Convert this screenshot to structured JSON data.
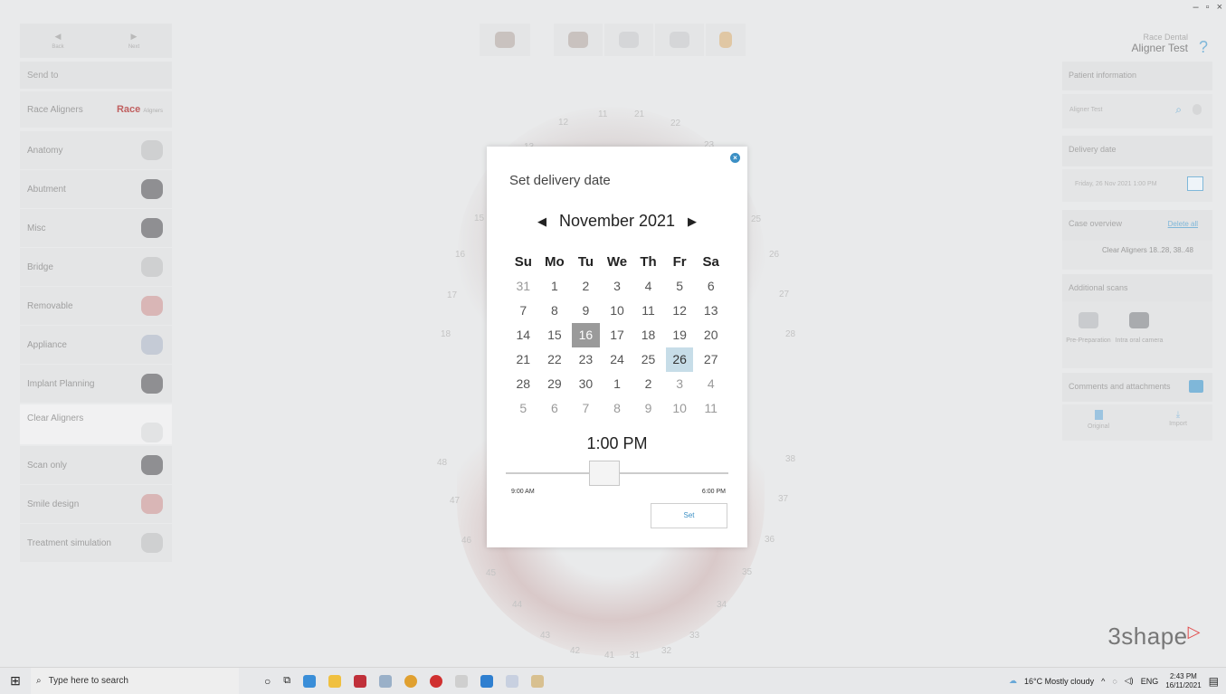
{
  "window": {
    "minimize": "–",
    "restore": "▫",
    "close": "×"
  },
  "nav": {
    "back": "Back",
    "next": "Next"
  },
  "left_panel": {
    "send_to": "Send to",
    "race_aligners": "Race Aligners",
    "race_logo": "Race",
    "race_logo_sub": "Aligners",
    "items": [
      {
        "label": "Anatomy"
      },
      {
        "label": "Abutment"
      },
      {
        "label": "Misc"
      },
      {
        "label": "Bridge"
      },
      {
        "label": "Removable"
      },
      {
        "label": "Appliance"
      },
      {
        "label": "Implant Planning"
      },
      {
        "label": "Clear Aligners"
      },
      {
        "label": "Scan only"
      },
      {
        "label": "Smile design"
      },
      {
        "label": "Treatment simulation"
      }
    ]
  },
  "teeth": {
    "t11": "11",
    "t12": "12",
    "t13": "13",
    "t15": "15",
    "t16": "16",
    "t17": "17",
    "t18": "18",
    "t21": "21",
    "t22": "22",
    "t23": "23",
    "t25": "25",
    "t26": "26",
    "t27": "27",
    "t28": "28",
    "t31": "31",
    "t32": "32",
    "t33": "33",
    "t34": "34",
    "t35": "35",
    "t36": "36",
    "t37": "37",
    "t38": "38",
    "t41": "41",
    "t42": "42",
    "t43": "43",
    "t44": "44",
    "t45": "45",
    "t46": "46",
    "t47": "47",
    "t48": "48"
  },
  "dialog": {
    "title": "Set delivery date",
    "month": "November 2021",
    "prev": "◀",
    "next": "▶",
    "weekdays": [
      "Su",
      "Mo",
      "Tu",
      "We",
      "Th",
      "Fr",
      "Sa"
    ],
    "days": [
      "31",
      "1",
      "2",
      "3",
      "4",
      "5",
      "6",
      "7",
      "8",
      "9",
      "10",
      "11",
      "12",
      "13",
      "14",
      "15",
      "16",
      "17",
      "18",
      "19",
      "20",
      "21",
      "22",
      "23",
      "24",
      "25",
      "26",
      "27",
      "28",
      "29",
      "30",
      "1",
      "2",
      "3",
      "4",
      "5",
      "6",
      "7",
      "8",
      "9",
      "10",
      "11"
    ],
    "time": "1:00 PM",
    "slider_min": "9:00 AM",
    "slider_max": "6:00 PM",
    "slider_value_fraction": 0.444,
    "set_label": "Set"
  },
  "right_panel": {
    "company": "Race Dental",
    "case_name": "Aligner Test",
    "help": "?",
    "patient_information": "Patient information",
    "patient_name": "Aligner Test",
    "delivery_date": "Delivery date",
    "delivery_value": "Friday, 26 Nov 2021 1:00 PM",
    "case_overview": "Case overview",
    "delete_all": "Delete all",
    "case_item": "Clear Aligners 18..28, 38..48",
    "additional_scans": "Additional scans",
    "scan_preparation": "Pre-Preparation",
    "scan_camera": "Intra oral camera",
    "comments": "Comments and attachments",
    "original": "Original",
    "import": "Import"
  },
  "brand": {
    "logo": "3shape",
    "accent": "#e24a4a"
  },
  "taskbar": {
    "search_placeholder": "Type here to search",
    "weather": "16°C  Mostly cloudy",
    "lang": "ENG",
    "time": "2:43 PM",
    "date": "16/11/2021"
  },
  "colors": {
    "accent_blue": "#3b8fc4",
    "selected_day": "#c7dde8",
    "today": "#9a9a9a"
  }
}
